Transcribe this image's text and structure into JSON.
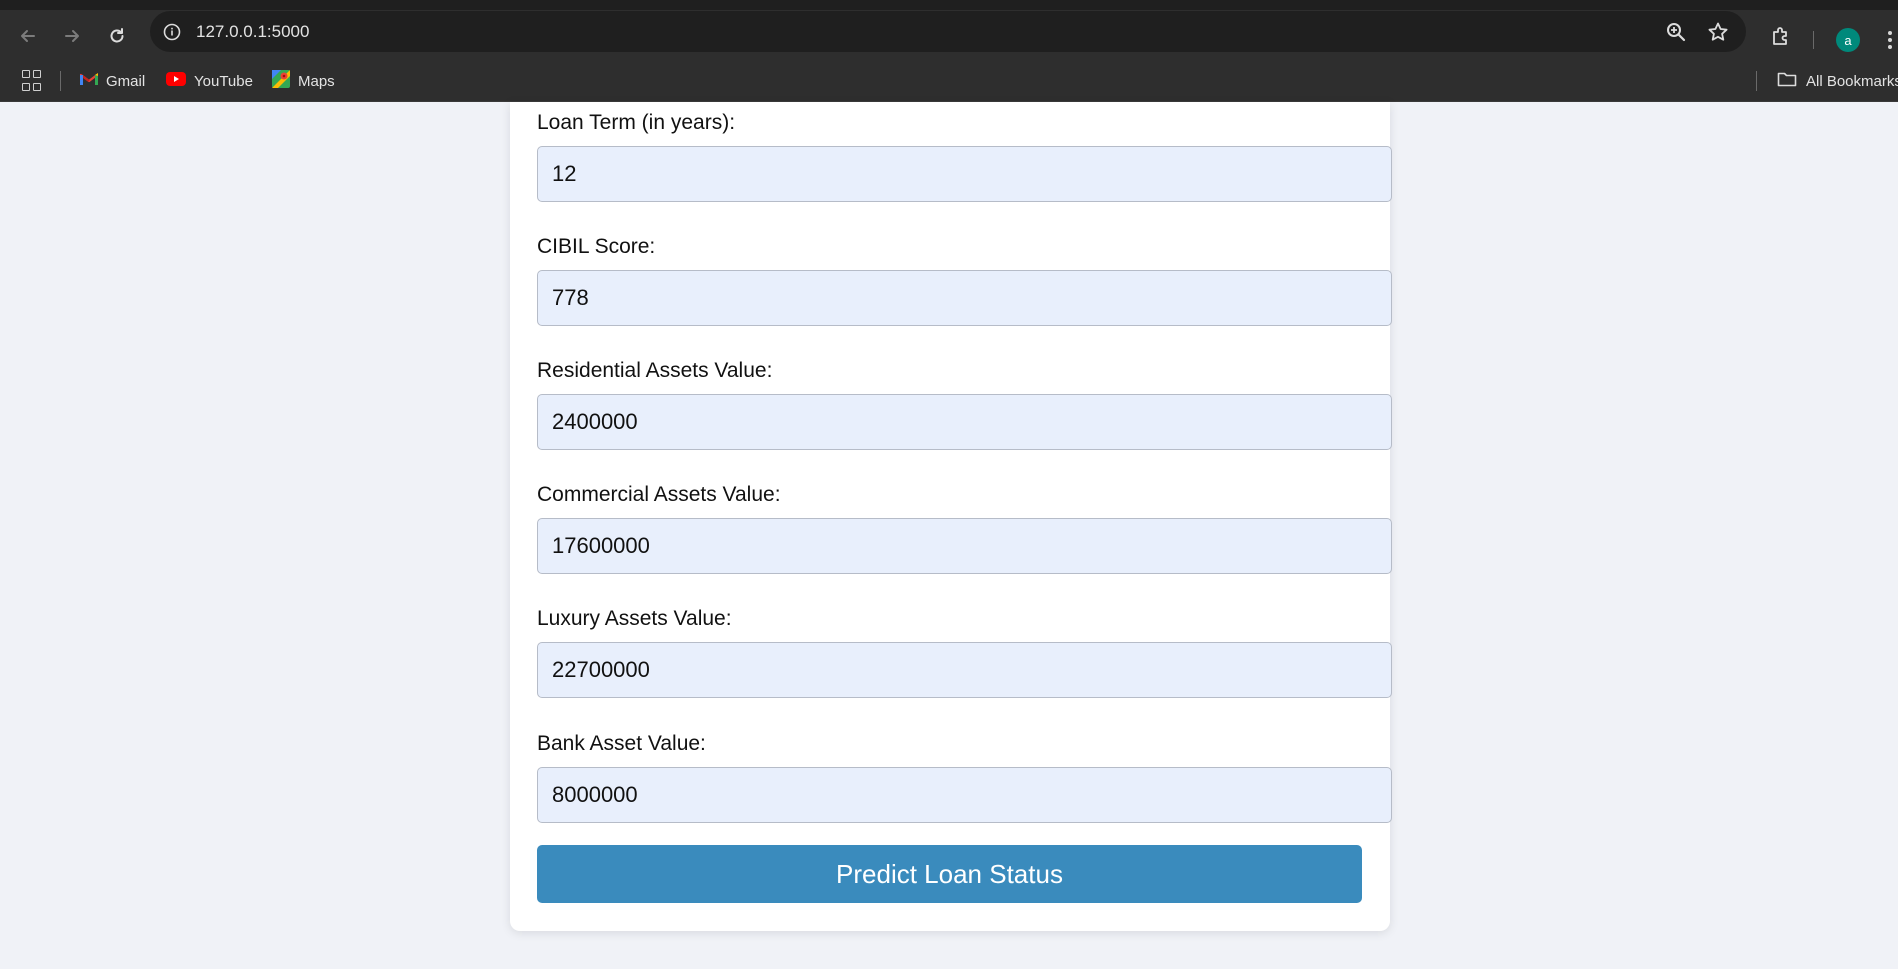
{
  "browser": {
    "url": "127.0.0.1:5000",
    "avatar_letter": "a",
    "icons": [
      "back-icon",
      "forward-icon",
      "reload-icon",
      "site-info-icon",
      "zoom-icon",
      "star-icon",
      "extensions-icon",
      "menu-icon"
    ]
  },
  "bookmarks": {
    "items": [
      {
        "label": "Gmail",
        "icon": "gmail-icon"
      },
      {
        "label": "YouTube",
        "icon": "youtube-icon"
      },
      {
        "label": "Maps",
        "icon": "maps-icon"
      }
    ],
    "all_bookmarks": "All Bookmarks"
  },
  "form": {
    "fields": [
      {
        "label": "Loan Term (in years):",
        "value": "12"
      },
      {
        "label": "CIBIL Score:",
        "value": "778"
      },
      {
        "label": "Residential Assets Value:",
        "value": "2400000"
      },
      {
        "label": "Commercial Assets Value:",
        "value": "17600000"
      },
      {
        "label": "Luxury Assets Value:",
        "value": "22700000"
      },
      {
        "label": "Bank Asset Value:",
        "value": "8000000"
      }
    ],
    "submit_label": "Predict Loan Status"
  },
  "colors": {
    "page_background": "#f0f2f7",
    "input_background": "#e8effc",
    "button": "#3a8bbd",
    "chrome": "#2e2e2e"
  }
}
